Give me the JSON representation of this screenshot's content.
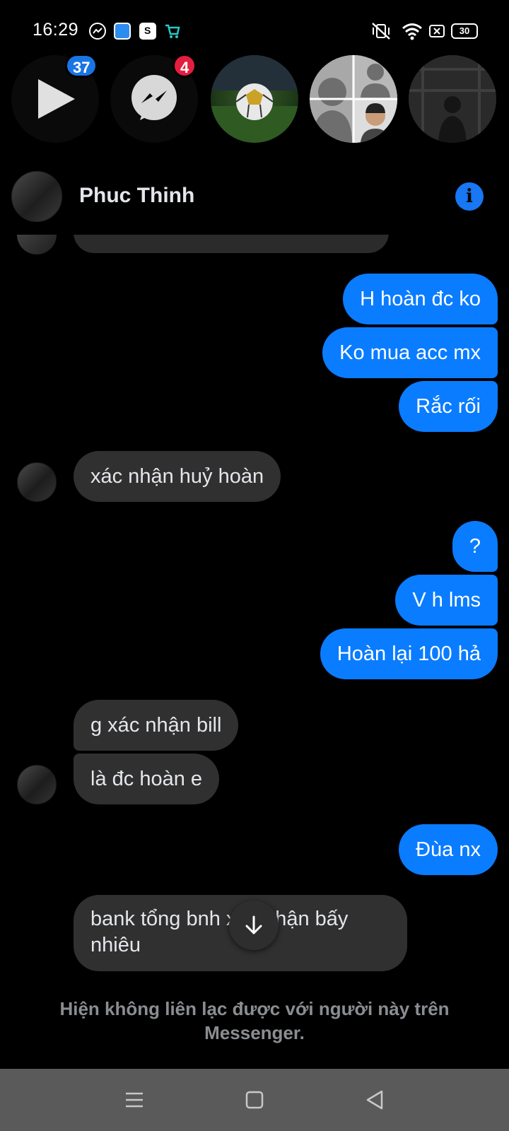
{
  "status_bar": {
    "time": "16:29",
    "battery": "30"
  },
  "chat_heads": {
    "video_badge": "37",
    "messenger_badge": "4"
  },
  "header": {
    "contact_name": "Phuc Thinh"
  },
  "messages": [
    {
      "from": "me",
      "text": "H hoàn đc ko"
    },
    {
      "from": "me",
      "text": "Ko mua acc mx"
    },
    {
      "from": "me",
      "text": "Rắc rối"
    },
    {
      "from": "them",
      "text": "xác nhận huỷ hoàn"
    },
    {
      "from": "me",
      "text": "?"
    },
    {
      "from": "me",
      "text": "V h lms"
    },
    {
      "from": "me",
      "text": "Hoàn lại 100 hả"
    },
    {
      "from": "them",
      "text": "g xác nhận bill"
    },
    {
      "from": "them",
      "text": "là đc hoàn e"
    },
    {
      "from": "me",
      "text": "Đùa nx"
    },
    {
      "from": "them",
      "text": "bank tổng bnh xác nhận bấy nhiêu"
    }
  ],
  "footer": {
    "unavailable": "Hiện không liên lạc được với người này trên Messenger."
  },
  "colors": {
    "outgoing_bubble": "#0a7cff",
    "incoming_bubble": "#303030",
    "badge_blue": "#1b74e4",
    "badge_red": "#e41e3f"
  }
}
